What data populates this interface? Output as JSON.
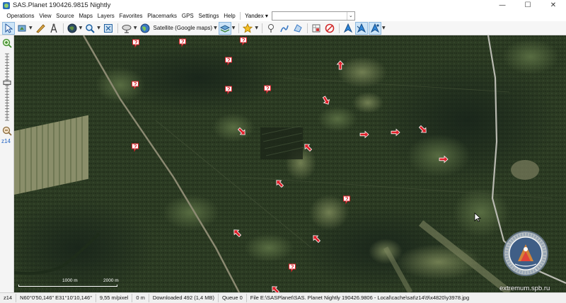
{
  "window": {
    "title": "SAS.Planet 190426.9815 Nightly",
    "app_icon": "sasplanet-globe-icon",
    "controls": {
      "minimize": "—",
      "maximize": "☐",
      "close": "✕"
    }
  },
  "menu": {
    "items": [
      "Operations",
      "View",
      "Source",
      "Maps",
      "Layers",
      "Favorites",
      "Placemarks",
      "GPS",
      "Settings",
      "Help"
    ],
    "search_provider": "Yandex ▾",
    "search_value": "",
    "search_chevron": "⌄"
  },
  "toolbar": {
    "map_source": "Satellite (Google maps)",
    "dropdown_glyph": "▼",
    "icons": [
      "select-cursor-icon",
      "move-tool-icon",
      "ruler-icon",
      "route-compass-icon",
      "globe-icon",
      "zoom-magnifier-icon",
      "fullscreen-grid-icon",
      "satellite-dish-icon",
      "map-source-globe-icon",
      "layers-icon",
      "favorites-star-icon",
      "placemark-pin-icon",
      "path-draw-icon",
      "polygon-select-icon",
      "marker-grid-icon",
      "stop-download-icon",
      "gps-marker-icon",
      "gps-track-icon",
      "gps-center-icon"
    ]
  },
  "zoom": {
    "level_label": "z14",
    "level": 14,
    "max_level": 24,
    "zoom_in_icon": "zoom-in-plus-icon",
    "zoom_out_icon": "zoom-out-magnifier-icon"
  },
  "map": {
    "scale_label_1": "1000 m",
    "scale_label_2": "2000 m",
    "watermark": "extremum.spb.ru",
    "marker_icons": [
      "red-arrow-marker-icon",
      "question-placemark-icon"
    ],
    "marker_color": "#e0202a",
    "cursor_icon": "mouse-pointer-icon",
    "emblem_icon": "rescue-team-emblem-icon"
  },
  "status": {
    "zoom": "z14",
    "coordinates": "N60°0'50,146\" E31°10'10,146\"",
    "resolution": "9,55 m/pixel",
    "distance": "0 m",
    "downloaded": "Downloaded 492 (1,4 MB)",
    "queue": "Queue 0",
    "file": "File E:\\SASPlanet\\SAS. Planet Nightly 190426.9806 - Local\\cache\\sat\\z14\\9\\x4820\\y3978.jpg"
  }
}
